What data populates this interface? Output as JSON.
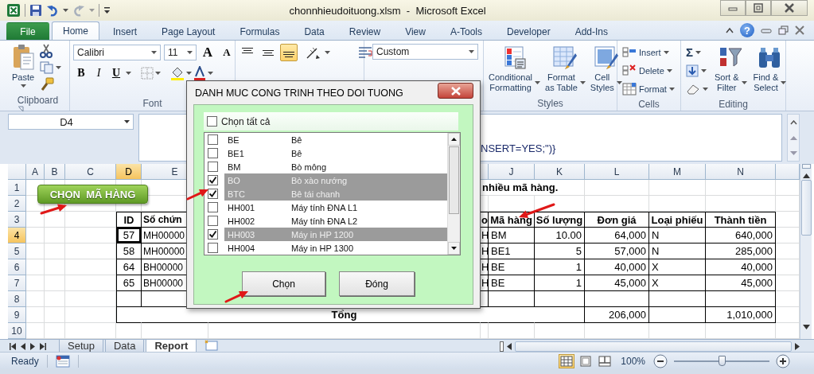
{
  "title_bar": {
    "title": "chonnhieudoituong.xlsm  -  Microsoft Excel"
  },
  "ribbon_tabs": [
    {
      "label": "File",
      "kind": "file",
      "selected": false
    },
    {
      "label": "Home",
      "kind": "tab",
      "selected": true
    },
    {
      "label": "Insert",
      "kind": "tab",
      "selected": false
    },
    {
      "label": "Page Layout",
      "kind": "tab",
      "selected": false
    },
    {
      "label": "Formulas",
      "kind": "tab",
      "selected": false
    },
    {
      "label": "Data",
      "kind": "tab",
      "selected": false
    },
    {
      "label": "Review",
      "kind": "tab",
      "selected": false
    },
    {
      "label": "View",
      "kind": "tab",
      "selected": false
    },
    {
      "label": "A-Tools",
      "kind": "tab",
      "selected": false
    },
    {
      "label": "Developer",
      "kind": "tab",
      "selected": false
    },
    {
      "label": "Add-Ins",
      "kind": "tab",
      "selected": false
    }
  ],
  "help_button": "?",
  "ribbon": {
    "clipboard": {
      "paste": "Paste",
      "label": "Clipboard"
    },
    "font": {
      "name": "Calibri",
      "size": "11",
      "grow": "A",
      "shrink": "A",
      "bold": "B",
      "italic": "I",
      "underline": "U",
      "label": "Font"
    },
    "alignment": {
      "buttons": [
        {
          "kind": "top",
          "selected": false
        },
        {
          "kind": "middle",
          "selected": false
        },
        {
          "kind": "bottom",
          "selected": true
        }
      ]
    },
    "number": {
      "format": "Custom"
    },
    "styles": {
      "buttons": [
        {
          "kind": "conditional",
          "lines": [
            "Conditional",
            "Formatting"
          ]
        },
        {
          "kind": "table",
          "lines": [
            "Format",
            "as Table"
          ]
        },
        {
          "kind": "cellstyles",
          "lines": [
            "Cell",
            "Styles"
          ]
        }
      ],
      "label": "Styles"
    },
    "cells": {
      "buttons": [
        {
          "kind": "insert",
          "label": "Insert"
        },
        {
          "kind": "delete",
          "label": "Delete"
        },
        {
          "kind": "format",
          "label": "Format"
        }
      ],
      "label": "Cells"
    },
    "editing": {
      "sum": "Σ",
      "buttons": [
        {
          "kind": "sort",
          "lines": [
            "Sort &",
            "Filter"
          ]
        },
        {
          "kind": "find",
          "lines": [
            "Find &",
            "Select"
          ]
        }
      ],
      "label": "Editing"
    }
  },
  "formula_bar": {
    "name_box": "D4",
    "formula": "NSERT=YES;\")}"
  },
  "sheet": {
    "columns": [
      {
        "label": "A",
        "selected": false
      },
      {
        "label": "B",
        "selected": false
      },
      {
        "label": "C",
        "selected": false
      },
      {
        "label": "D",
        "selected": true
      },
      {
        "label": "E",
        "selected": false
      },
      {
        "label": "J",
        "selected": false
      },
      {
        "label": "K",
        "selected": false
      },
      {
        "label": "L",
        "selected": false
      },
      {
        "label": "M",
        "selected": false
      },
      {
        "label": "N",
        "selected": false
      }
    ],
    "rows": [
      {
        "number": "1",
        "kind": "title",
        "selected": false,
        "cells": {
          "I": "nhiều mã hàng."
        }
      },
      {
        "number": "2",
        "kind": "blank",
        "selected": false
      },
      {
        "number": "3",
        "kind": "header",
        "selected": false,
        "cells": {
          "D": "ID",
          "E": "Số chứn",
          "I": "o",
          "J": "Mã hàng",
          "K": "Số lượng",
          "L": "Đơn giá",
          "M": "Loại phiếu",
          "N": "Thành tiền"
        }
      },
      {
        "number": "4",
        "kind": "data",
        "selected": true,
        "cells": {
          "D": "57",
          "E": "MH00000",
          "I": "H",
          "J": "BM",
          "K": "10.00",
          "L": "64,000",
          "M": "N",
          "N": "640,000"
        }
      },
      {
        "number": "5",
        "kind": "data",
        "selected": false,
        "cells": {
          "D": "58",
          "E": "MH00000",
          "I": "H",
          "J": "BE1",
          "K": "5",
          "L": "57,000",
          "M": "N",
          "N": "285,000"
        }
      },
      {
        "number": "6",
        "kind": "data",
        "selected": false,
        "cells": {
          "D": "64",
          "E": "BH00000",
          "I": "H",
          "J": "BE",
          "K": "1",
          "L": "40,000",
          "M": "X",
          "N": "40,000"
        }
      },
      {
        "number": "7",
        "kind": "data",
        "selected": false,
        "cells": {
          "D": "65",
          "E": "BH00000",
          "I": "H",
          "J": "BE",
          "K": "1",
          "L": "45,000",
          "M": "X",
          "N": "45,000"
        }
      },
      {
        "number": "8",
        "kind": "data",
        "selected": false
      },
      {
        "number": "9",
        "kind": "total",
        "selected": false,
        "cells": {
          "F": "Tổng",
          "L": "206,000",
          "N": "1,010,000"
        }
      },
      {
        "number": "10",
        "kind": "blank",
        "selected": false
      }
    ]
  },
  "sheet_button": {
    "label": "CHỌN  MÃ HÀNG"
  },
  "dialog": {
    "title": "DANH MUC CONG TRINH THEO DOI TUONG",
    "select_all": {
      "label": "Chọn tất cả",
      "checked": false
    },
    "items": [
      {
        "code": "BE",
        "name": "Bê",
        "checked": false,
        "selected": false
      },
      {
        "code": "BE1",
        "name": "Bê",
        "checked": false,
        "selected": false
      },
      {
        "code": "BM",
        "name": "Bò mông",
        "checked": false,
        "selected": false
      },
      {
        "code": "BO",
        "name": "Bò xào nướng",
        "checked": true,
        "selected": true
      },
      {
        "code": "BTC",
        "name": "Bê tái chanh",
        "checked": true,
        "selected": true
      },
      {
        "code": "HH001",
        "name": "Máy tính ĐNA L1",
        "checked": false,
        "selected": false
      },
      {
        "code": "HH002",
        "name": "Máy tính ĐNA L2",
        "checked": false,
        "selected": false
      },
      {
        "code": "HH003",
        "name": "Máy in HP 1200",
        "checked": true,
        "selected": true
      },
      {
        "code": "HH004",
        "name": "Máy in HP 1300",
        "checked": false,
        "selected": false
      }
    ],
    "buttons": [
      "Chọn",
      "Đóng"
    ]
  },
  "sheet_tabs": [
    {
      "label": "Setup",
      "selected": false
    },
    {
      "label": "Data",
      "selected": false
    },
    {
      "label": "Report",
      "selected": true
    }
  ],
  "status_bar": {
    "status": "Ready",
    "views": [
      {
        "kind": "normal",
        "selected": true
      },
      {
        "kind": "page_layout",
        "selected": false
      },
      {
        "kind": "page_break",
        "selected": false
      }
    ],
    "zoom": "100%",
    "zoom_slider": {
      "level": 0.5
    }
  }
}
